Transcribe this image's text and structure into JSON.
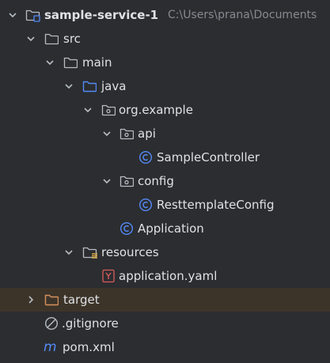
{
  "tree": {
    "project": {
      "name": "sample-service-1",
      "path": "C:\\Users\\prana\\Documents"
    },
    "items": {
      "src": "src",
      "main": "main",
      "java": "java",
      "package": "org.example",
      "api": "api",
      "sample_controller": "SampleController",
      "config": "config",
      "resttemplate_config": "ResttemplateConfig",
      "application": "Application",
      "resources": "resources",
      "application_yaml": "application.yaml",
      "target": "target",
      "gitignore": ".gitignore",
      "pom": "pom.xml"
    }
  },
  "colors": {
    "background": "#2b2d30",
    "text": "#dfe1e5",
    "muted_text": "#868a91",
    "folder": "#b7bcc3",
    "source_folder": "#548af7",
    "class_icon": "#548af7",
    "yaml_icon": "#db5c5c",
    "maven_icon": "#548af7",
    "target_folder": "#d6915f",
    "excluded_row_bg": "#3d3429"
  },
  "icons": {
    "chevron_expanded": "chevron-down-icon",
    "chevron_collapsed": "chevron-right-icon",
    "module": "module-folder-icon",
    "folder": "folder-icon",
    "source_root": "source-root-folder-icon",
    "package": "package-folder-icon",
    "resources_root": "resources-root-folder-icon",
    "class": "java-class-icon",
    "yaml": "yaml-file-icon",
    "excluded_folder": "excluded-folder-icon",
    "ignore_file": "gitignore-icon",
    "maven": "maven-icon"
  }
}
